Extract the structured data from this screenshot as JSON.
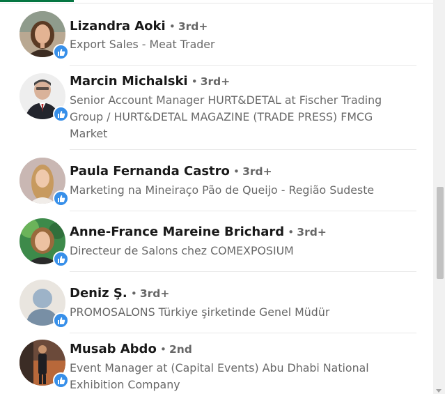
{
  "colors": {
    "accent_green": "#057642",
    "reaction_blue": "#378fe9",
    "degree_grey": "#666666"
  },
  "reaction_icon": "like-thumbs-up-icon",
  "people": [
    {
      "name": "Lizandra Aoki",
      "degree": "3rd+",
      "headline": "Export Sales - Meat Trader"
    },
    {
      "name": "Marcin Michalski",
      "degree": "3rd+",
      "headline": "Senior Account Manager HURT&DETAL at Fischer Trading Group / HURT&DETAL MAGAZINE (TRADE PRESS) FMCG Market"
    },
    {
      "name": "Paula Fernanda Castro",
      "degree": "3rd+",
      "headline": "Marketing na Mineiraço Pão de Queijo - Região Sudeste"
    },
    {
      "name": "Anne-France Mareine Brichard",
      "degree": "3rd+",
      "headline": "Directeur de Salons chez COMEXPOSIUM"
    },
    {
      "name": "Deniz Ş.",
      "degree": "3rd+",
      "headline": "PROMOSALONS Türkiye şirketinde Genel Müdür"
    },
    {
      "name": "Musab Abdo",
      "degree": "2nd",
      "headline": "Event Manager at (Capital Events) Abu Dhabi National Exhibition Company"
    }
  ]
}
